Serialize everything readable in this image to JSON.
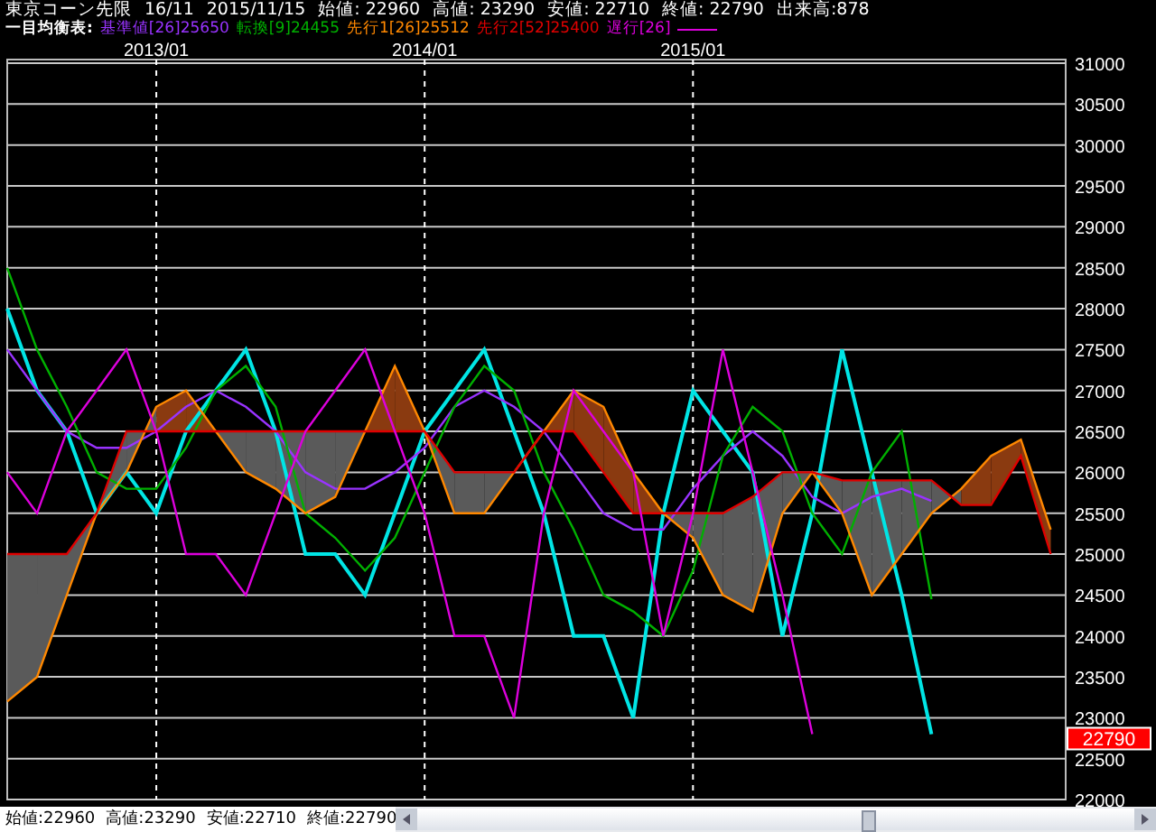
{
  "header": {
    "contract": "16/11",
    "date": "2015/11/15",
    "quotes": [
      "始値: 22960",
      "高値: 23290",
      "安値: 22710",
      "終値: 22790",
      "出来高:878"
    ]
  },
  "chart": {
    "legend_title": "一目均衡表:",
    "legend_values": [
      "[26]25650",
      "[9]24455",
      "[26]25512",
      "[52]25400",
      "[26]"
    ],
    "last_price_tag": "22790",
    "chart_data": {
      "type": "line",
      "grid": true,
      "categories": [
        null,
        null,
        null,
        null,
        null,
        "2013/01",
        null,
        null,
        null,
        null,
        null,
        null,
        null,
        null,
        "2014/01",
        null,
        null,
        null,
        null,
        null,
        null,
        null,
        null,
        "2015/01",
        null,
        null,
        null,
        null,
        null,
        null,
        null,
        null,
        null,
        null,
        null,
        null
      ],
      "ylim": [
        22000,
        31000
      ],
      "yticks": [
        22000,
        22500,
        23000,
        23500,
        24000,
        24500,
        25000,
        25500,
        26000,
        26500,
        27000,
        27500,
        28000,
        28500,
        29000,
        29500,
        30000,
        30500,
        31000
      ],
      "series": [
        {
          "name": "東京コーン先限",
          "color": "#00e5e5",
          "values": [
            28000,
            27000,
            26500,
            25500,
            26000,
            25500,
            26500,
            27000,
            27500,
            26500,
            25000,
            25000,
            24500,
            25500,
            26500,
            27000,
            27500,
            26500,
            25500,
            24000,
            24000,
            23000,
            25500,
            27000,
            26500,
            26000,
            24000,
            25500,
            27500,
            26000,
            24500,
            22800,
            null,
            null,
            null,
            null
          ]
        },
        {
          "name": "基準値",
          "color": "#9933ff",
          "values": [
            27500,
            27000,
            26500,
            26300,
            26300,
            26500,
            26800,
            27000,
            26800,
            26500,
            26000,
            25800,
            25800,
            26000,
            26300,
            26800,
            27000,
            26800,
            26500,
            26000,
            25500,
            25300,
            25300,
            25800,
            26200,
            26500,
            26200,
            25700,
            25500,
            25700,
            25800,
            25650,
            null,
            null,
            null,
            null
          ]
        },
        {
          "name": "転換",
          "color": "#00b000",
          "values": [
            28500,
            27500,
            26800,
            26000,
            25800,
            25800,
            26300,
            27000,
            27300,
            26800,
            25500,
            25200,
            24800,
            25200,
            26000,
            26800,
            27300,
            27000,
            26000,
            25300,
            24500,
            24300,
            24000,
            24800,
            26200,
            26800,
            26500,
            25500,
            25000,
            26000,
            26500,
            24450,
            null,
            null,
            null,
            null
          ]
        },
        {
          "name": "先行1",
          "color": "#ff8800",
          "values": [
            23200,
            23500,
            24500,
            25500,
            26000,
            26800,
            27000,
            26500,
            26000,
            25800,
            25500,
            25700,
            26500,
            27300,
            26500,
            25500,
            25500,
            26000,
            26500,
            27000,
            26800,
            26000,
            25500,
            25200,
            24500,
            24300,
            25500,
            26000,
            25500,
            24500,
            25000,
            25500,
            25800,
            26200,
            26400,
            25300
          ]
        },
        {
          "name": "先行2",
          "color": "#e00000",
          "values": [
            25000,
            25000,
            25000,
            25500,
            26500,
            26500,
            26500,
            26500,
            26500,
            26500,
            26500,
            26500,
            26500,
            26500,
            26500,
            26000,
            26000,
            26000,
            26500,
            26500,
            26000,
            25500,
            25500,
            25500,
            25500,
            25700,
            26000,
            26000,
            25900,
            25900,
            25900,
            25900,
            25600,
            25600,
            26200,
            25000
          ]
        },
        {
          "name": "遅行",
          "color": "#dd00dd",
          "values": [
            26000,
            25500,
            26500,
            27000,
            27500,
            26500,
            25000,
            25000,
            24500,
            25500,
            26500,
            27000,
            27500,
            26500,
            25500,
            24000,
            24000,
            23000,
            25500,
            27000,
            26500,
            26000,
            24000,
            25500,
            27500,
            26000,
            24500,
            22800,
            null,
            null,
            null,
            null,
            null,
            null,
            null,
            null
          ]
        }
      ]
    }
  },
  "status_bar": {
    "quotes": [
      "始値:22960",
      "高値:23290",
      "安値:22710",
      "終値:22790"
    ]
  }
}
